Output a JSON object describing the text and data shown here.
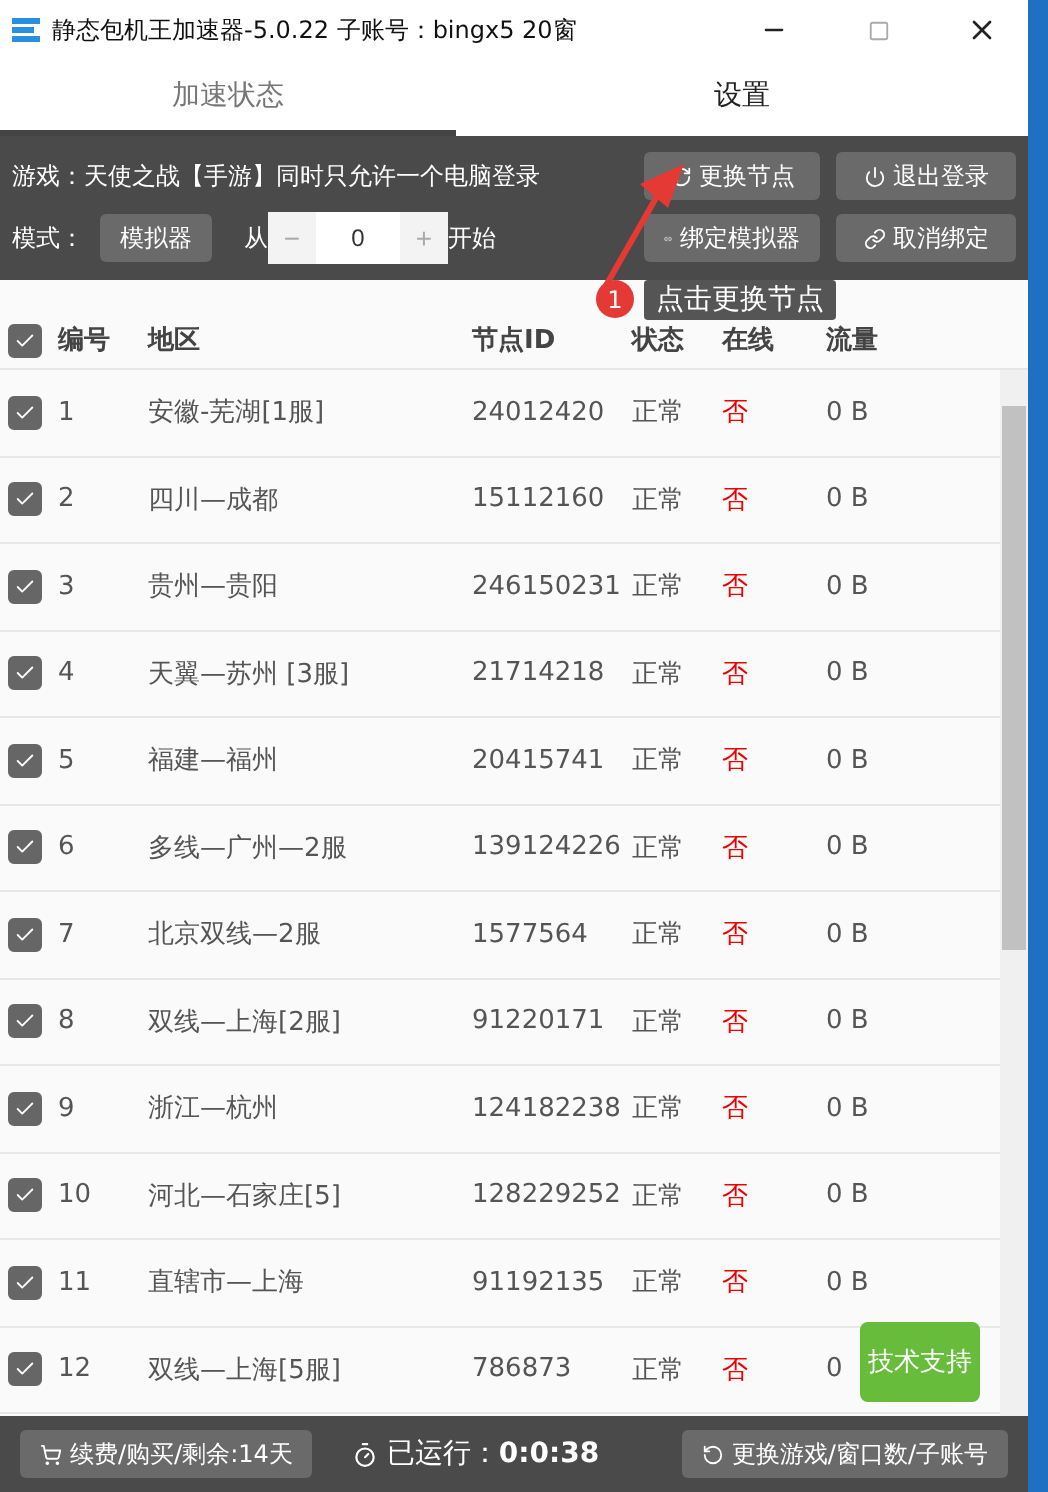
{
  "window": {
    "title": "静态包机王加速器-5.0.22 子账号：bingx5 20窗"
  },
  "tabs": [
    {
      "label": "加速状态",
      "selected": true
    },
    {
      "label": "设置",
      "selected": false
    }
  ],
  "toolbar": {
    "game_text": "游戏：天使之战【手游】同时只允许一个电脑登录",
    "mode_label": "模式：",
    "mode_button": "模拟器",
    "from_label": "从",
    "minus": "−",
    "start_value": "0",
    "plus": "+",
    "start_label": "开始",
    "buttons": [
      {
        "label": "更换节点"
      },
      {
        "label": "退出登录"
      },
      {
        "label": "绑定模拟器"
      },
      {
        "label": "取消绑定"
      }
    ]
  },
  "tooltip": {
    "badge": "1",
    "text": "点击更换节点"
  },
  "table": {
    "all_checked": true,
    "columns": [
      "编号",
      "地区",
      "节点ID",
      "状态",
      "在线",
      "流量"
    ],
    "rows": [
      {
        "checked": true,
        "no": "1",
        "region": "安徽-芜湖[1服]",
        "node_id": "24012420",
        "status": "正常",
        "online": "否",
        "traffic": "0 B"
      },
      {
        "checked": true,
        "no": "2",
        "region": "四川—成都",
        "node_id": "15112160",
        "status": "正常",
        "online": "否",
        "traffic": "0 B"
      },
      {
        "checked": true,
        "no": "3",
        "region": "贵州—贵阳",
        "node_id": "246150231",
        "status": "正常",
        "online": "否",
        "traffic": "0 B"
      },
      {
        "checked": true,
        "no": "4",
        "region": "天翼—苏州 [3服]",
        "node_id": "21714218",
        "status": "正常",
        "online": "否",
        "traffic": "0 B"
      },
      {
        "checked": true,
        "no": "5",
        "region": "福建—福州",
        "node_id": "20415741",
        "status": "正常",
        "online": "否",
        "traffic": "0 B"
      },
      {
        "checked": true,
        "no": "6",
        "region": "多线—广州—2服",
        "node_id": "139124226",
        "status": "正常",
        "online": "否",
        "traffic": "0 B"
      },
      {
        "checked": true,
        "no": "7",
        "region": "北京双线—2服",
        "node_id": "1577564",
        "status": "正常",
        "online": "否",
        "traffic": "0 B"
      },
      {
        "checked": true,
        "no": "8",
        "region": "双线—上海[2服]",
        "node_id": "91220171",
        "status": "正常",
        "online": "否",
        "traffic": "0 B"
      },
      {
        "checked": true,
        "no": "9",
        "region": "浙江—杭州",
        "node_id": "124182238",
        "status": "正常",
        "online": "否",
        "traffic": "0 B"
      },
      {
        "checked": true,
        "no": "10",
        "region": "河北—石家庄[5]",
        "node_id": "128229252",
        "status": "正常",
        "online": "否",
        "traffic": "0 B"
      },
      {
        "checked": true,
        "no": "11",
        "region": "直辖市—上海",
        "node_id": "91192135",
        "status": "正常",
        "online": "否",
        "traffic": "0 B"
      },
      {
        "checked": true,
        "no": "12",
        "region": "双线—上海[5服]",
        "node_id": "786873",
        "status": "正常",
        "online": "否",
        "traffic": "0"
      }
    ]
  },
  "support_button": "技术支持",
  "footer": {
    "renew": "续费/购买/剩余:14天",
    "runtime_label": "已运行：",
    "runtime": "0:0:38",
    "switch": "更换游戏/窗口数/子账号"
  }
}
